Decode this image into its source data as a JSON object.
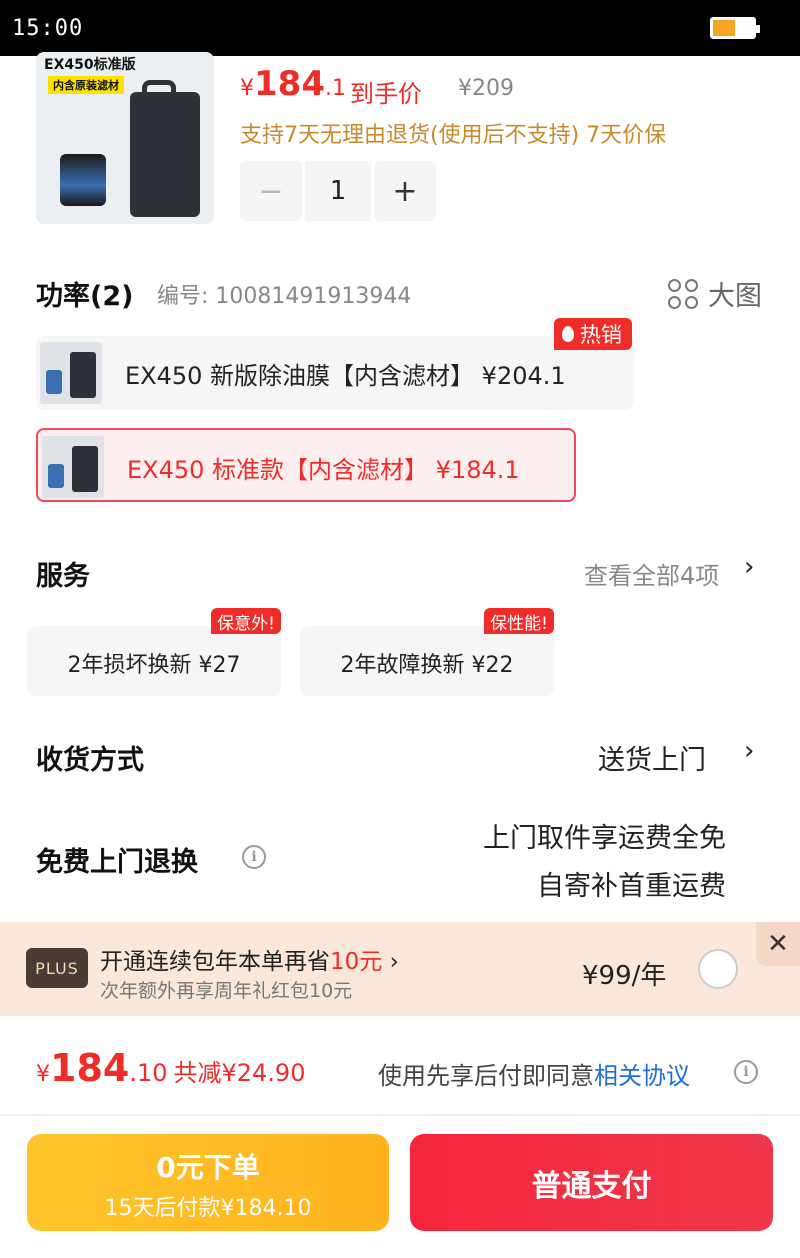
{
  "status": {
    "time": "15:00"
  },
  "product": {
    "thumb_title": "EX450标准版",
    "thumb_tag": "内含原装滤材",
    "price_symbol": "¥",
    "price_int": "184",
    "price_dec": ".1",
    "price_label": "到手价",
    "orig_price": "¥209",
    "return_note": "支持7天无理由退货(使用后不支持) 7天价保",
    "quantity": "1",
    "minus": "−",
    "plus": "+"
  },
  "spec": {
    "title": "功率(2)",
    "number": "编号: 10081491913944",
    "big_pic": "大图",
    "hot_badge": "热销",
    "options": [
      {
        "label": "EX450 新版除油膜【内含滤材】 ¥204.1",
        "selected": false
      },
      {
        "label": "EX450 标准款【内含滤材】 ¥184.1",
        "selected": true
      }
    ]
  },
  "service": {
    "title": "服务",
    "view_all": "查看全部4项",
    "chevron": "›",
    "items": [
      {
        "label": "2年损坏换新  ¥27",
        "badge": "保意外!"
      },
      {
        "label": "2年故障换新  ¥22",
        "badge": "保性能!"
      }
    ]
  },
  "delivery": {
    "title": "收货方式",
    "value": "送货上门",
    "chevron": "›"
  },
  "returns": {
    "title": "免费上门退换",
    "info": "i",
    "line1": "上门取件享运费全免",
    "line2": "自寄补首重运费"
  },
  "plus": {
    "logo": "PLUS",
    "line1_a": "开通连续包年本单再省",
    "line1_b": "10元",
    "line1_c": " ›",
    "line2": "次年额外再享周年礼红包10元",
    "price": "¥99/年",
    "close": "✕"
  },
  "footer": {
    "price_symbol": "¥",
    "price_int": "184",
    "price_dec": ".10",
    "discount": "共减¥24.90",
    "agree_text": "使用先享后付即同意",
    "agree_link": "相关协议",
    "info": "i",
    "bnpl_line1": "0元下单",
    "bnpl_line2": "15天后付款¥184.10",
    "pay_label": "普通支付"
  },
  "colors": {
    "accent": "#f02c28",
    "gold": "#ffc52a",
    "link": "#1f6fd6"
  }
}
